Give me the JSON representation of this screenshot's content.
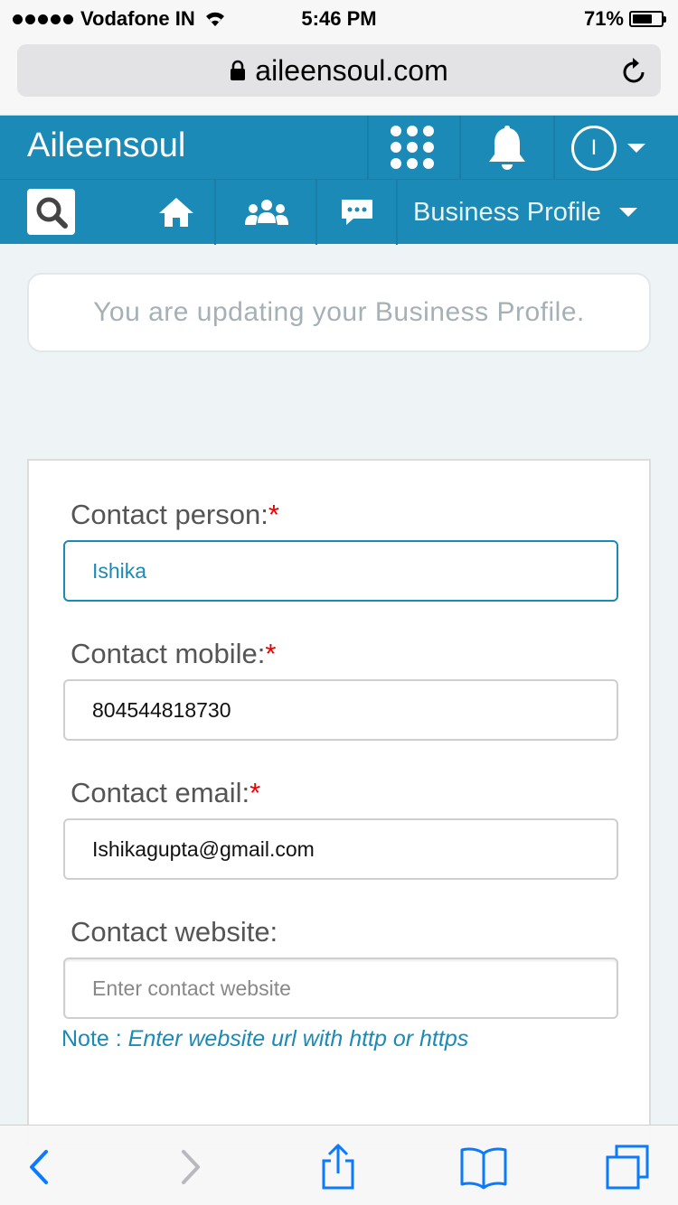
{
  "status_bar": {
    "carrier": "Vodafone IN",
    "time": "5:46 PM",
    "battery": "71%",
    "battery_level": 0.71
  },
  "browser": {
    "url": "aileensoul.com"
  },
  "header": {
    "brand": "Aileensoul",
    "avatar_initial": "I",
    "brand_color": "#1b8ab6"
  },
  "nav": {
    "profile_menu_label": "Business Profile"
  },
  "notice": {
    "text": "You are updating your Business Profile."
  },
  "form": {
    "fields": [
      {
        "label": "Contact person:",
        "required": "*",
        "value": "Ishika"
      },
      {
        "label": "Contact mobile:",
        "required": "*",
        "value": "804544818730"
      },
      {
        "label": "Contact email:",
        "required": "*",
        "value": "Ishikagupta@gmail.com"
      },
      {
        "label": "Contact website:",
        "placeholder": "Enter contact website"
      }
    ],
    "note_prefix": "Note : ",
    "note_text": "Enter website url with http or https"
  },
  "icons": {
    "header": [
      "apps-grid-icon",
      "bell-icon",
      "chevron-down-icon"
    ],
    "nav": [
      "search-icon",
      "home-icon",
      "people-icon",
      "chat-icon"
    ],
    "toolbar": [
      "back-icon",
      "forward-icon",
      "share-icon",
      "bookmarks-icon",
      "tabs-icon"
    ]
  }
}
